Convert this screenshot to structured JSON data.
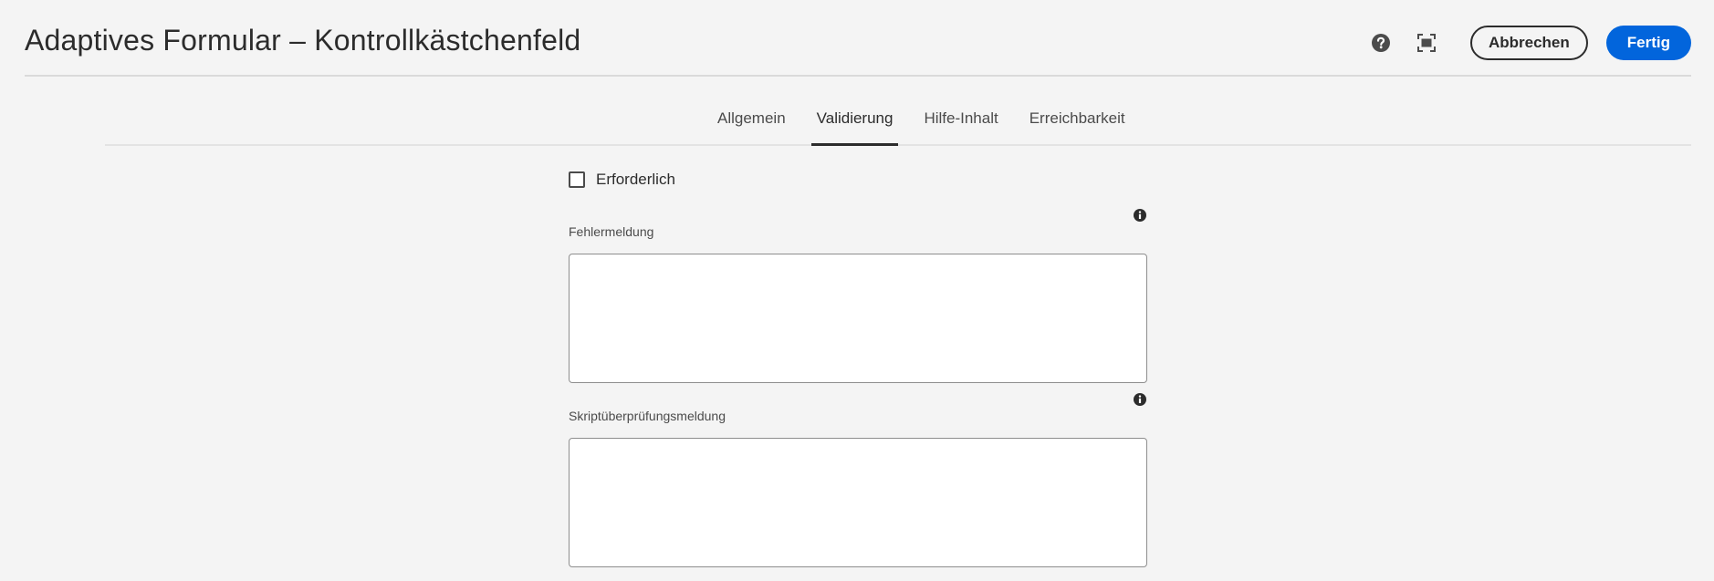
{
  "header": {
    "title": "Adaptives Formular – Kontrollkästchenfeld",
    "help_icon": "help-circle-icon",
    "fullscreen_icon": "fullscreen-icon",
    "cancel_label": "Abbrechen",
    "done_label": "Fertig"
  },
  "tabs": [
    {
      "label": "Allgemein",
      "active": false
    },
    {
      "label": "Validierung",
      "active": true
    },
    {
      "label": "Hilfe-Inhalt",
      "active": false
    },
    {
      "label": "Erreichbarkeit",
      "active": false
    }
  ],
  "form": {
    "required_label": "Erforderlich",
    "required_checked": false,
    "error_message": {
      "label": "Fehlermeldung",
      "value": ""
    },
    "script_message": {
      "label": "Skriptüberprüfungsmeldung",
      "value": ""
    }
  },
  "colors": {
    "primary": "#0265dc",
    "background": "#f4f4f4",
    "text": "#2c2c2c"
  }
}
